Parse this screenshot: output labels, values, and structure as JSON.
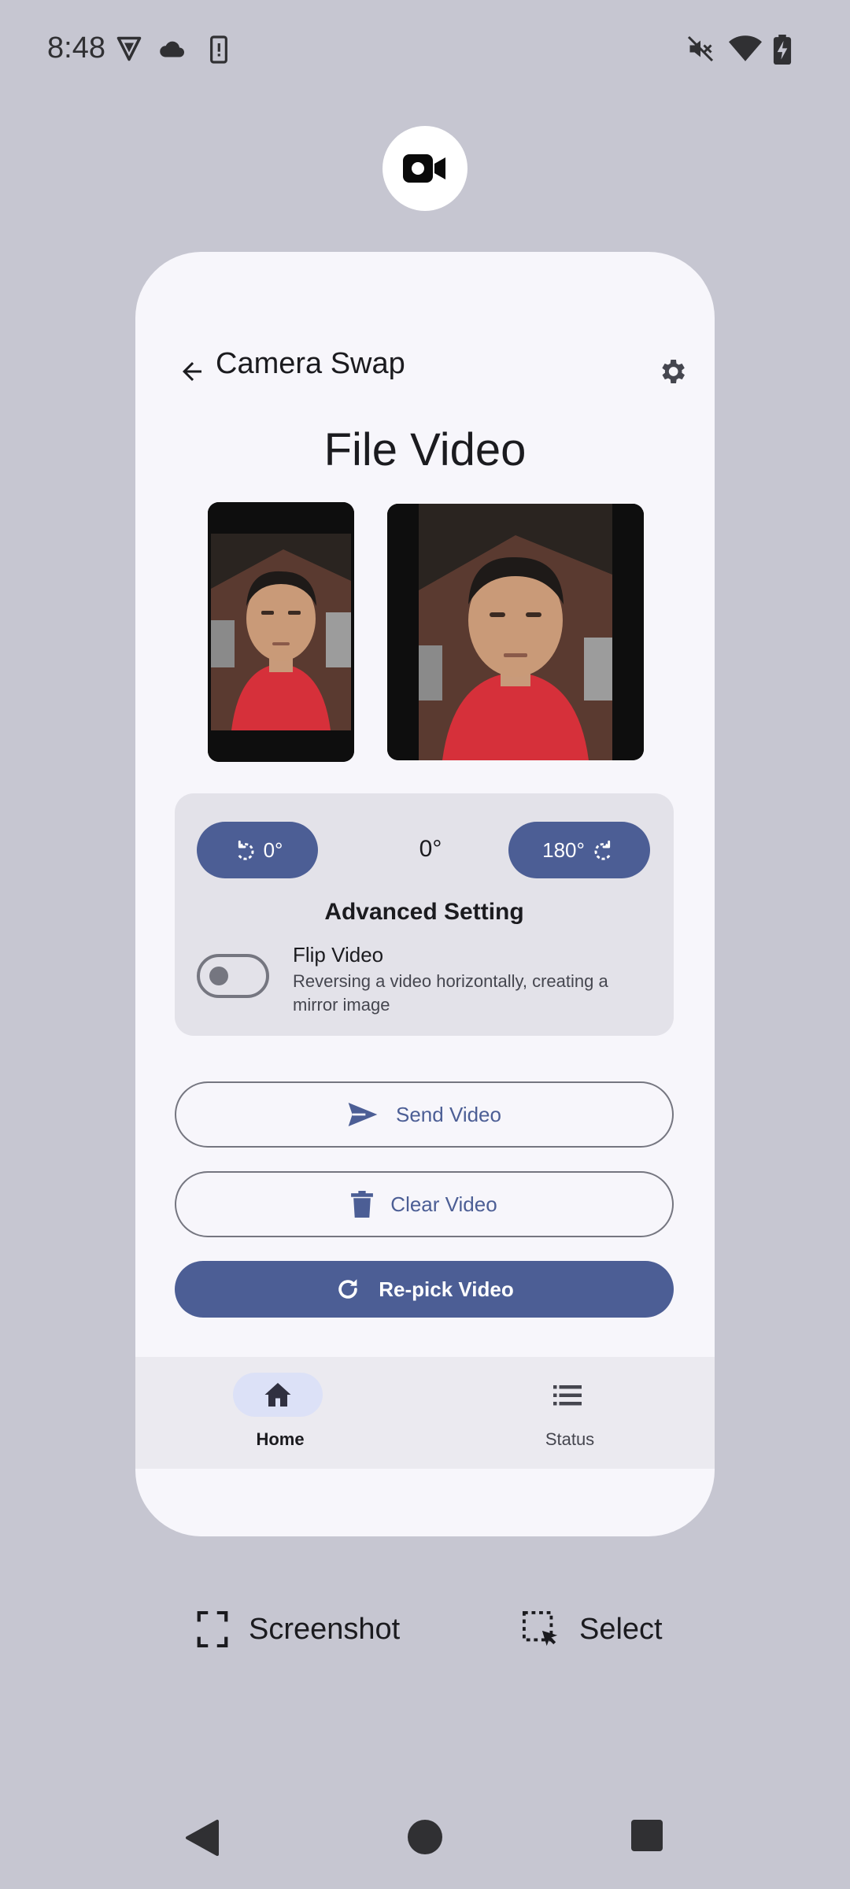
{
  "status_bar": {
    "time": "8:48",
    "icons_left": [
      "vpn-shield-icon",
      "cloud-icon",
      "phone-alert-icon"
    ],
    "icons_right": [
      "mute-icon",
      "wifi-icon",
      "battery-charging-icon"
    ]
  },
  "app_icon": "video-camera-icon",
  "app_bar": {
    "title": "Camera Swap",
    "back_icon": "arrow-back-icon",
    "settings_icon": "gear-icon"
  },
  "page_title": "File Video",
  "previews": [
    "portrait-video-preview",
    "square-video-preview"
  ],
  "rotation": {
    "left_button_label": "0°",
    "current_value": "0°",
    "right_button_label": "180°"
  },
  "advanced": {
    "title": "Advanced Setting",
    "flip_label": "Flip Video",
    "flip_description": "Reversing a video horizontally, creating a mirror image",
    "flip_enabled": false
  },
  "actions": {
    "send": "Send Video",
    "clear": "Clear Video",
    "repick": "Re-pick Video"
  },
  "bottom_nav": {
    "items": [
      {
        "label": "Home",
        "icon": "home-icon",
        "selected": true
      },
      {
        "label": "Status",
        "icon": "list-icon",
        "selected": false
      }
    ]
  },
  "screenshot_actions": {
    "screenshot": "Screenshot",
    "select": "Select"
  },
  "colors": {
    "background": "#c6c6d1",
    "card": "#f7f6fb",
    "primary": "#4c5e95",
    "panel": "#e3e2e9",
    "nav_indicator": "#dce1f7"
  }
}
